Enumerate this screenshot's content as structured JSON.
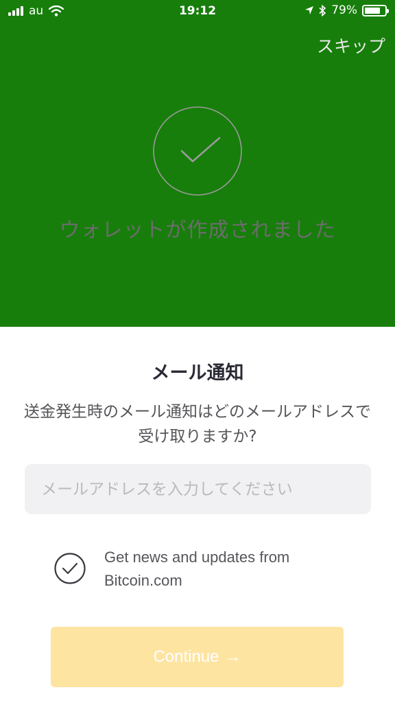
{
  "status_bar": {
    "carrier": "au",
    "time": "19:12",
    "battery_percent": "79%",
    "battery_level": 0.79,
    "icons": [
      "signal-icon",
      "wifi-icon",
      "location-arrow-icon",
      "bluetooth-icon",
      "battery-icon"
    ]
  },
  "header": {
    "skip_label": "スキップ",
    "success_icon": "checkmark-circle-icon",
    "success_message": "ウォレットが作成されました"
  },
  "email_section": {
    "title": "メール通知",
    "description": "送金発生時のメール通知はどのメールアドレスで受け取りますか?",
    "email_placeholder": "メールアドレスを入力してください",
    "email_value": ""
  },
  "newsletter": {
    "checked": true,
    "label": "Get news and updates from Bitcoin.com"
  },
  "continue_button": {
    "label": "Continue",
    "arrow": "→",
    "enabled": false
  },
  "colors": {
    "hero_background": "#177e0b",
    "button_background": "#fde4a1",
    "input_background": "#f1f1f3"
  }
}
